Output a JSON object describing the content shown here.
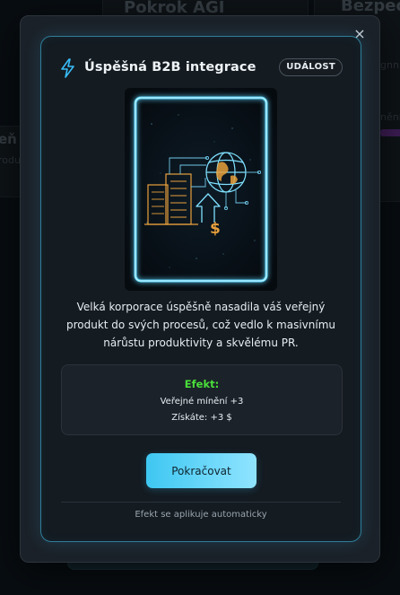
{
  "background": {
    "card1_title": "Pokrok AGI",
    "card2_title": "Bezpeč",
    "left_fragment": "eň",
    "left_fragment_small": "rodu",
    "right_fragment_1": "gnn",
    "right_fragment_2": "nění"
  },
  "dialog": {
    "close_label": "×"
  },
  "event": {
    "title": "Úspěšná B2B integrace",
    "badge": "UDÁLOST",
    "description": "Velká korporace úspěšně nasadila váš veřejný produkt do svých procesů, což vedlo k masivnímu nárůstu produktivity a skvělému PR.",
    "effect": {
      "heading": "Efekt:",
      "lines": [
        "Veřejné mínění +3",
        "Získáte: +3 $"
      ]
    },
    "continue_label": "Pokračovat",
    "footnote": "Efekt se aplikuje automaticky"
  },
  "colors": {
    "accent": "#38bdf8",
    "effect_green": "#4ade3a",
    "art_orange": "#e8a03c"
  },
  "icons": {
    "title_icon": "lightning-bolt-icon",
    "close_icon": "close-icon"
  }
}
